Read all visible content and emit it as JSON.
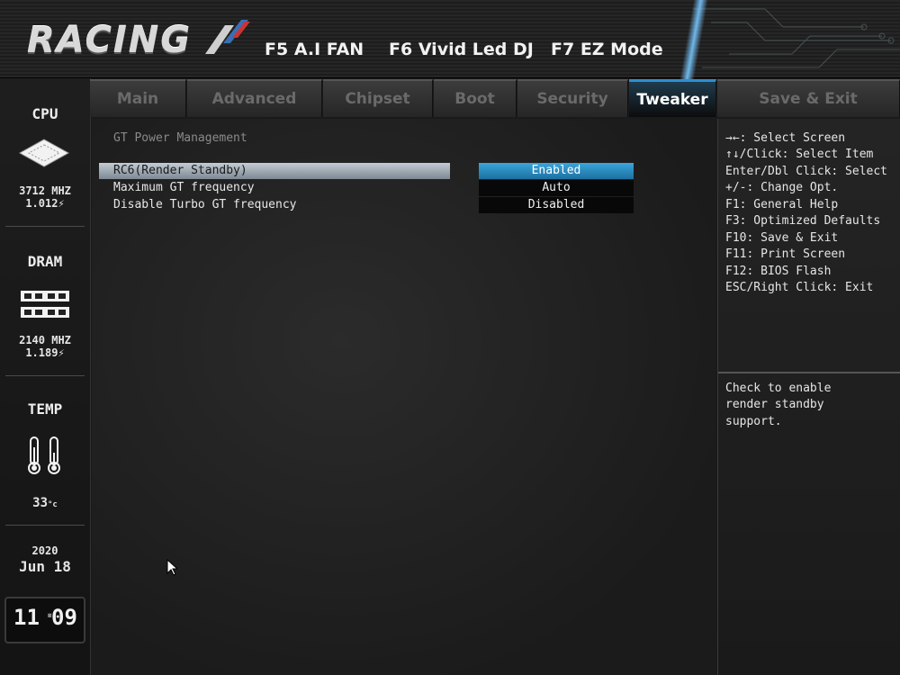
{
  "header": {
    "logo_text": "RACING",
    "hotkeys": [
      "F5 A.I FAN",
      "F6 Vivid Led DJ",
      "F7 EZ Mode"
    ]
  },
  "sidebar": {
    "cpu": {
      "label": "CPU",
      "freq": "3712 MHZ",
      "volt": "1.012"
    },
    "dram": {
      "label": "DRAM",
      "freq": "2140 MHZ",
      "volt": "1.189"
    },
    "temp": {
      "label": "TEMP",
      "value": "33"
    },
    "date": {
      "year": "2020",
      "month_day": "Jun 18"
    },
    "time": {
      "hours": "11",
      "minutes": "09"
    }
  },
  "tabs": [
    {
      "label": "Main"
    },
    {
      "label": "Advanced"
    },
    {
      "label": "Chipset"
    },
    {
      "label": "Boot"
    },
    {
      "label": "Security"
    },
    {
      "label": "Tweaker"
    },
    {
      "label": "Save & Exit"
    }
  ],
  "active_tab": "Tweaker",
  "main": {
    "section_title": "GT Power Management",
    "settings": [
      {
        "name": "RC6(Render Standby)",
        "value": "Enabled"
      },
      {
        "name": "Maximum GT frequency",
        "value": "Auto"
      },
      {
        "name": "Disable Turbo GT frequency",
        "value": "Disabled"
      }
    ]
  },
  "help": {
    "keys": [
      "→←: Select Screen",
      "↑↓/Click: Select Item",
      "Enter/Dbl Click: Select",
      "+/-: Change Opt.",
      "F1: General Help",
      "F3: Optimized Defaults",
      "F10: Save & Exit",
      "F11: Print Screen",
      "F12: BIOS Flash",
      "ESC/Right Click: Exit"
    ],
    "description": [
      "Check to enable",
      "render standby",
      "support."
    ]
  },
  "colors": {
    "accent": "#2c8fd1",
    "selected_option": "#3aa6dc",
    "background": "#1a1a1a"
  }
}
